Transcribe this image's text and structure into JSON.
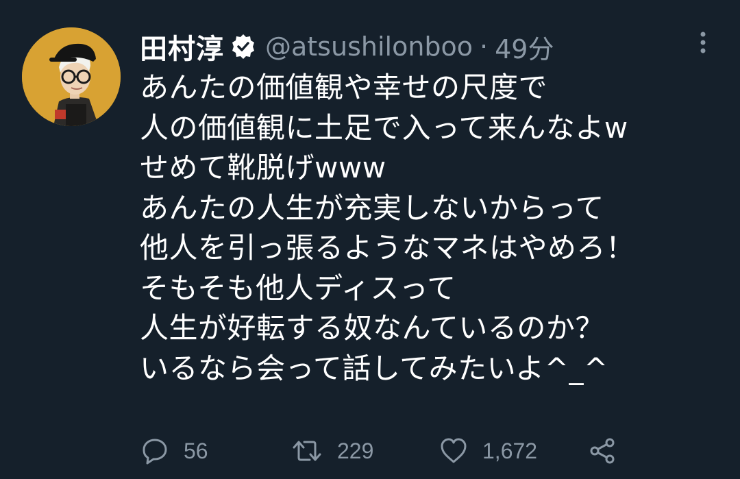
{
  "tweet": {
    "display_name": "田村淳",
    "handle": "@atsushilonboo",
    "separator": "·",
    "time": "49分",
    "verified_icon": "verified-badge-icon",
    "more_icon": "more-vertical-icon",
    "avatar_icon": "avatar-illustration",
    "lines": [
      "あんたの価値観や幸せの尺度で",
      "人の価値観に土足で入って来んなよw",
      "せめて靴脱げwww",
      "あんたの人生が充実しないからって",
      "他人を引っ張るようなマネはやめろ！",
      "そもそも他人ディスって",
      "人生が好転する奴なんているのか？",
      "いるなら会って話してみたいよ^_^"
    ]
  },
  "actions": {
    "reply": {
      "icon": "reply-icon",
      "count": "56"
    },
    "retweet": {
      "icon": "retweet-icon",
      "count": "229"
    },
    "like": {
      "icon": "heart-icon",
      "count": "1,672"
    },
    "share": {
      "icon": "share-icon"
    }
  },
  "colors": {
    "background": "#15202b",
    "text": "#ffffff",
    "muted": "#8b98a5",
    "avatar_bg": "#d8a233"
  }
}
